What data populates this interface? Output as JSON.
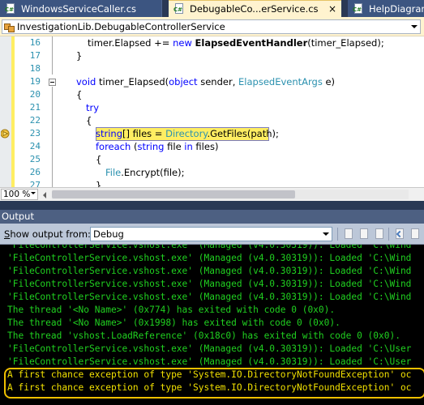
{
  "tabs": [
    {
      "label": "WindowsServiceCaller.cs",
      "active": false
    },
    {
      "label": "DebugableCo...erService.cs",
      "active": true,
      "close_glyph": "×"
    },
    {
      "label": "HelpDiagram",
      "active": false
    }
  ],
  "navbar": {
    "type_selector": "InvestigationLib.DebugableControllerService"
  },
  "editor": {
    "line_numbers": [
      "16",
      "17",
      "18",
      "19",
      "20",
      "21",
      "22",
      "23",
      "24",
      "25",
      "26",
      "27"
    ],
    "current_line": "23",
    "code_lines": [
      [
        {
          "t": "timer.Elapsed += ",
          "c": ""
        },
        {
          "t": "new",
          "c": "kw"
        },
        {
          "t": " ",
          "c": ""
        },
        {
          "t": "ElapsedEventHandler",
          "c": "bold"
        },
        {
          "t": "(timer_Elapsed);",
          "c": ""
        }
      ],
      [
        {
          "t": "}",
          "c": ""
        }
      ],
      [],
      [
        {
          "t": "void",
          "c": "kw"
        },
        {
          "t": " timer_Elapsed(",
          "c": ""
        },
        {
          "t": "object",
          "c": "kw"
        },
        {
          "t": " sender, ",
          "c": ""
        },
        {
          "t": "ElapsedEventArgs",
          "c": "ty"
        },
        {
          "t": " e)",
          "c": ""
        }
      ],
      [
        {
          "t": "{",
          "c": ""
        }
      ],
      [
        {
          "t": "try",
          "c": "kw"
        }
      ],
      [
        {
          "t": "{",
          "c": ""
        }
      ],
      [
        {
          "t": "string",
          "c": "kw"
        },
        {
          "t": "[] files = ",
          "c": ""
        },
        {
          "t": "Directory",
          "c": "ty"
        },
        {
          "t": ".GetFiles(path);",
          "c": ""
        }
      ],
      [
        {
          "t": "foreach",
          "c": "kw"
        },
        {
          "t": " (",
          "c": ""
        },
        {
          "t": "string",
          "c": "kw"
        },
        {
          "t": " file ",
          "c": ""
        },
        {
          "t": "in",
          "c": "kw"
        },
        {
          "t": " files)",
          "c": ""
        }
      ],
      [
        {
          "t": "{",
          "c": ""
        }
      ],
      [
        {
          "t": "File",
          "c": "ty"
        },
        {
          "t": ".Encrypt(file);",
          "c": ""
        }
      ],
      [
        {
          "t": "}",
          "c": ""
        }
      ]
    ]
  },
  "zoom": {
    "value": "100 %"
  },
  "output": {
    "title": "Output",
    "show_output_from_label": "Show output from:",
    "source": "Debug",
    "lines": [
      {
        "text": "'FileControllerService.vshost.exe' (Managed (v4.0.30319)): Loaded 'C:\\Wind",
        "color": "green"
      },
      {
        "text": "'FileControllerService.vshost.exe' (Managed (v4.0.30319)): Loaded 'C:\\Wind",
        "color": "green"
      },
      {
        "text": "'FileControllerService.vshost.exe' (Managed (v4.0.30319)): Loaded 'C:\\Wind",
        "color": "green"
      },
      {
        "text": "'FileControllerService.vshost.exe' (Managed (v4.0.30319)): Loaded 'C:\\Wind",
        "color": "green"
      },
      {
        "text": "'FileControllerService.vshost.exe' (Managed (v4.0.30319)): Loaded 'C:\\Wind",
        "color": "green"
      },
      {
        "text": "The thread '<No Name>' (0x774) has exited with code 0 (0x0).",
        "color": "green"
      },
      {
        "text": "The thread '<No Name>' (0x1998) has exited with code 0 (0x0).",
        "color": "green"
      },
      {
        "text": "The thread 'vshost.LoadReference' (0x18c0) has exited with code 0 (0x0).",
        "color": "green"
      },
      {
        "text": "'FileControllerService.vshost.exe' (Managed (v4.0.30319)): Loaded 'C:\\User",
        "color": "green"
      },
      {
        "text": "'FileControllerService.vshost.exe' (Managed (v4.0.30319)): Loaded 'C:\\User",
        "color": "green"
      },
      {
        "text": "A first chance exception of type 'System.IO.DirectoryNotFoundException' oc",
        "color": "yellow"
      },
      {
        "text": "A first chance exception of type 'System.IO.DirectoryNotFoundException' oc",
        "color": "yellow"
      }
    ]
  },
  "colors": {
    "chrome": "#293955",
    "active_tab": "#fff3cf",
    "current_line": "#ffee62",
    "output_bg": "#000000",
    "output_text": "#20d020",
    "highlight": "#f0c000"
  }
}
